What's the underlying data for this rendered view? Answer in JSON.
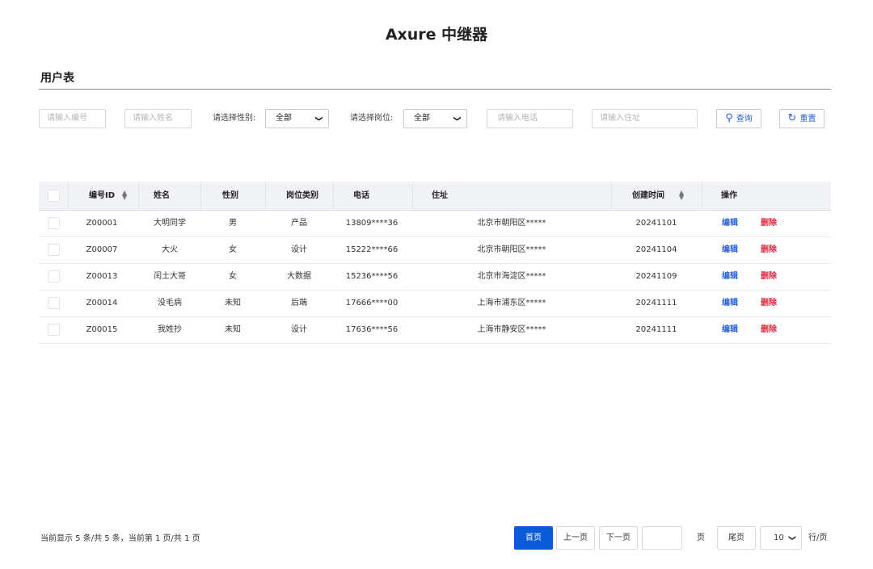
{
  "app_title": "Axure 中继器",
  "section_title": "用户表",
  "filters": {
    "id_placeholder": "请输入编号",
    "name_placeholder": "请输入姓名",
    "gender_label": "请选择性别:",
    "gender_value": "全部",
    "post_label": "请选择岗位:",
    "post_value": "全部",
    "phone_placeholder": "请输入电话",
    "address_placeholder": "请输入住址",
    "search_label": "查询",
    "reset_label": "重置"
  },
  "table": {
    "headers": {
      "id": "编号ID",
      "name": "姓名",
      "gender": "性别",
      "post": "岗位类别",
      "phone": "电话",
      "address": "住址",
      "created": "创建时间",
      "actions": "操作"
    },
    "rows": [
      {
        "id": "Z00001",
        "name": "大明同学",
        "gender": "男",
        "post": "产品",
        "phone": "13809****36",
        "address": "北京市朝阳区*****",
        "created": "20241101",
        "edit": "编辑",
        "delete": "删除"
      },
      {
        "id": "Z00007",
        "name": "大火",
        "gender": "女",
        "post": "设计",
        "phone": "15222****66",
        "address": "北京市朝阳区*****",
        "created": "20241104",
        "edit": "编辑",
        "delete": "删除"
      },
      {
        "id": "Z00013",
        "name": "闰土大哥",
        "gender": "女",
        "post": "大数据",
        "phone": "15236****56",
        "address": "北京市海淀区*****",
        "created": "20241109",
        "edit": "编辑",
        "delete": "删除"
      },
      {
        "id": "Z00014",
        "name": "没毛病",
        "gender": "未知",
        "post": "后端",
        "phone": "17666****00",
        "address": "上海市浦东区*****",
        "created": "20241111",
        "edit": "编辑",
        "delete": "删除"
      },
      {
        "id": "Z00015",
        "name": "我姓抄",
        "gender": "未知",
        "post": "设计",
        "phone": "17636****56",
        "address": "上海市静安区*****",
        "created": "20241111",
        "edit": "编辑",
        "delete": "删除"
      }
    ]
  },
  "pagination": {
    "info": "当前显示 5 条/共 5 条，当前第 1 页/共 1 页",
    "first": "首页",
    "prev": "上一页",
    "next": "下一页",
    "page_input_value": "",
    "page_unit": "页",
    "last": "尾页",
    "page_size": "10",
    "page_size_unit": "行/页"
  },
  "colors": {
    "accent": "#0b5ad6",
    "link": "#2962d9",
    "danger": "#e0263d",
    "header_bg": "#f0f2f5"
  },
  "icons": {
    "search": "search-icon",
    "reset": "refresh-icon",
    "sort": "sort-icon",
    "dropdown": "chevron-down-icon"
  }
}
